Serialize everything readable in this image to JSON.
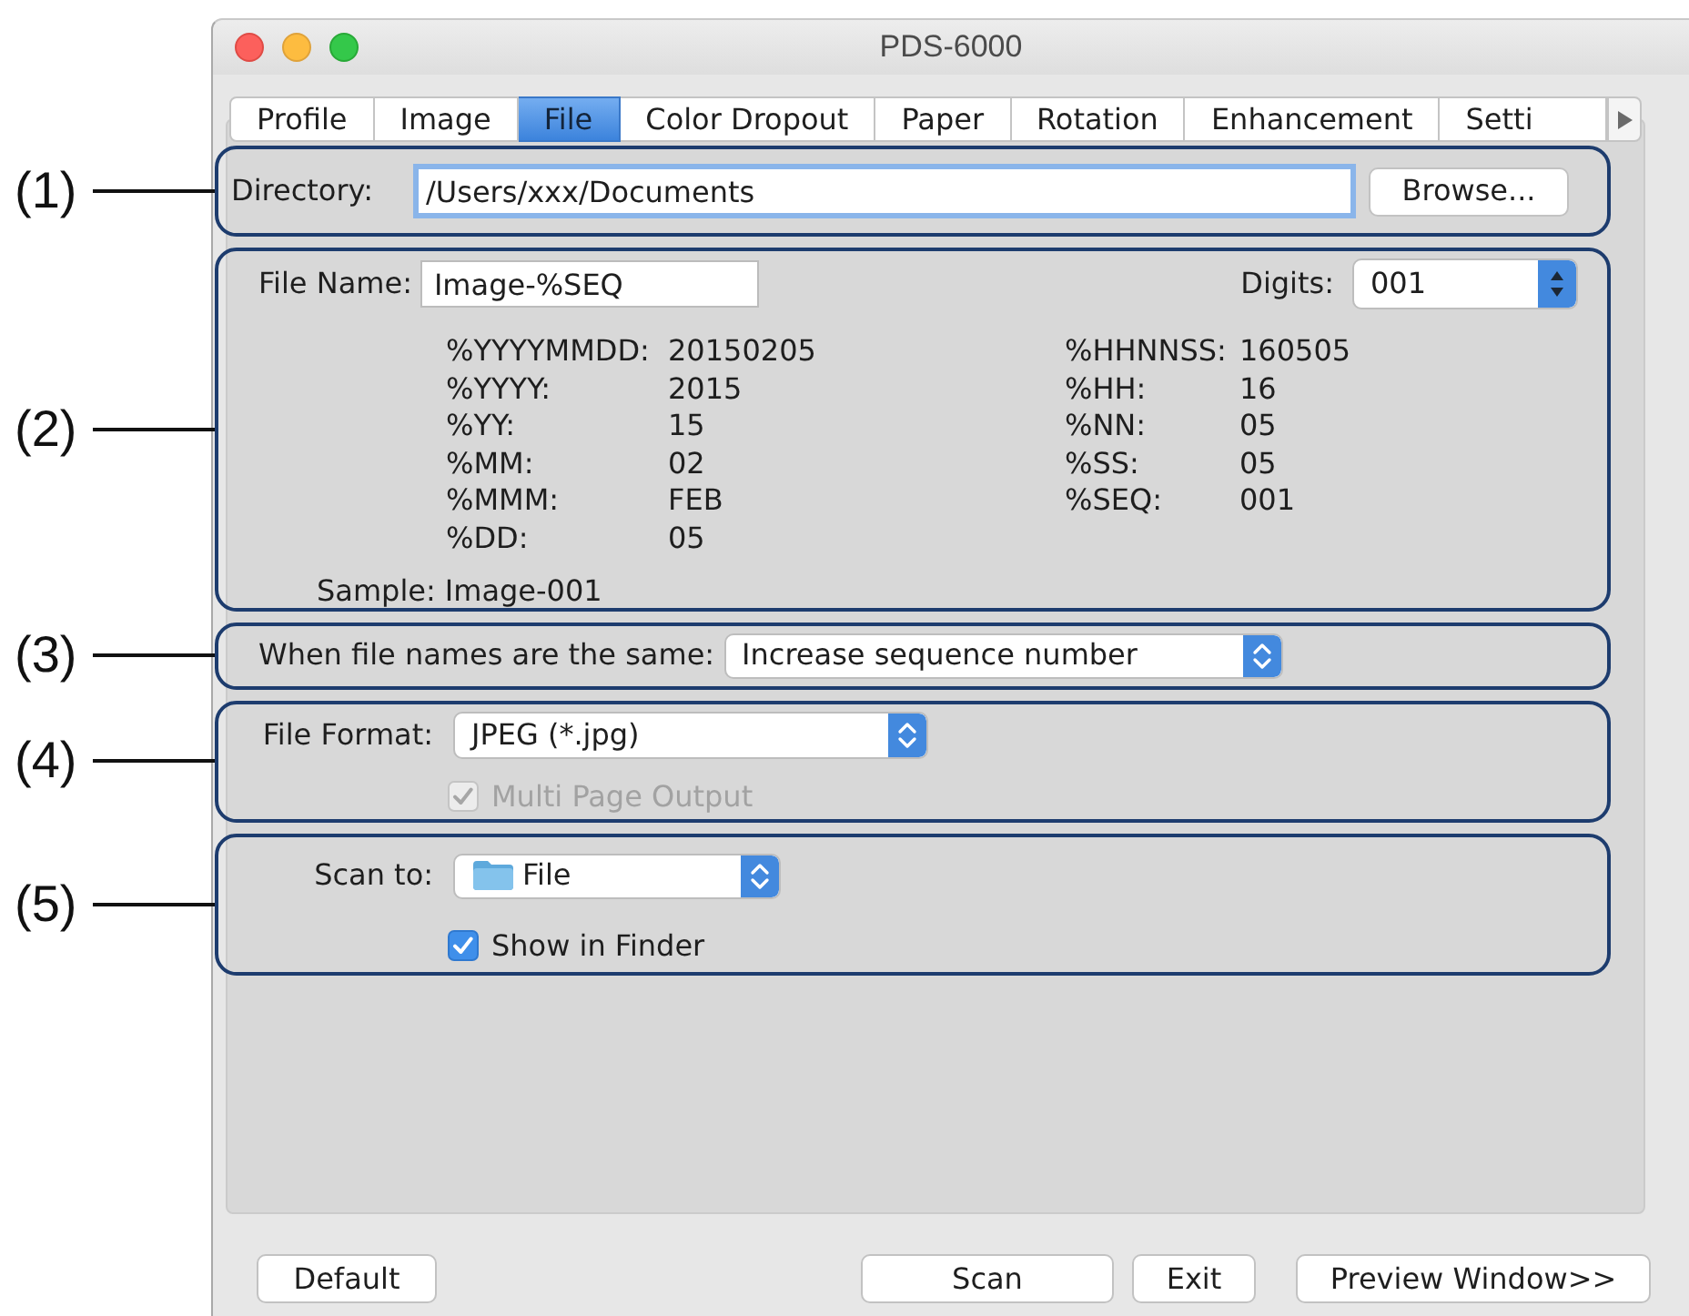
{
  "window": {
    "title": "PDS-6000"
  },
  "tabs": [
    {
      "label": "Profile",
      "selected": false
    },
    {
      "label": "Image",
      "selected": false
    },
    {
      "label": "File",
      "selected": true
    },
    {
      "label": "Color Dropout",
      "selected": false
    },
    {
      "label": "Paper",
      "selected": false
    },
    {
      "label": "Rotation",
      "selected": false
    },
    {
      "label": "Enhancement",
      "selected": false
    },
    {
      "label": "Setti",
      "selected": false
    }
  ],
  "directory": {
    "callout": "(1)",
    "label": "Directory:",
    "value": "/Users/xxx/Documents",
    "focused": true,
    "browse_button": "Browse..."
  },
  "file_name": {
    "callout": "(2)",
    "label": "File Name:",
    "value": "Image-%SEQ",
    "digits_label": "Digits:",
    "digits_value": "001",
    "date_tokens": [
      {
        "token": "%YYYYMMDD:",
        "value": "20150205"
      },
      {
        "token": "%YYYY:",
        "value": "2015"
      },
      {
        "token": "%YY:",
        "value": "15"
      },
      {
        "token": "%MM:",
        "value": "02"
      },
      {
        "token": "%MMM:",
        "value": "FEB"
      },
      {
        "token": "%DD:",
        "value": "05"
      }
    ],
    "time_tokens": [
      {
        "token": "%HHNNSS:",
        "value": "160505"
      },
      {
        "token": "%HH:",
        "value": "16"
      },
      {
        "token": "%NN:",
        "value": "05"
      },
      {
        "token": "%SS:",
        "value": "05"
      },
      {
        "token": "%SEQ:",
        "value": "001"
      }
    ],
    "sample_label": "Sample:",
    "sample_value": "Image-001"
  },
  "same_names": {
    "callout": "(3)",
    "label": "When file names are the same:",
    "value": "Increase sequence number"
  },
  "file_format": {
    "callout": "(4)",
    "label": "File Format:",
    "value": "JPEG (*.jpg)",
    "multi_page": {
      "label": "Multi Page Output",
      "checked": true,
      "disabled": true
    }
  },
  "scan_to": {
    "callout": "(5)",
    "label": "Scan to:",
    "value": "File",
    "show_in_finder": {
      "label": "Show in Finder",
      "checked": true,
      "disabled": false
    }
  },
  "buttons": [
    "Default",
    "Scan",
    "Exit",
    "Preview Window>>"
  ]
}
